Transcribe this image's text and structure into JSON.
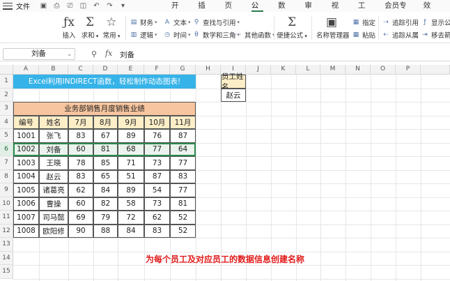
{
  "menubar": {
    "file_label": "文件",
    "tabs": [
      "开始",
      "插入",
      "页面",
      "公式",
      "数据",
      "审阅",
      "视图",
      "工具",
      "会员专享",
      "效率"
    ],
    "active_tab": "公式"
  },
  "ribbon": {
    "insert_function": "插入",
    "autosum": "求和",
    "common": "常用",
    "finance": "财务",
    "text": "文本",
    "lookup": "查找与引用",
    "logic": "逻辑",
    "time": "时间",
    "math": "数学和三角",
    "other": "其他函数",
    "quick_formula": "便捷公式",
    "name_manager": "名称管理器",
    "specify": "指定",
    "paste": "粘贴",
    "trace_precedents": "追踪引用",
    "trace_dependents": "追踪从属",
    "show_formula": "显示公",
    "remove_arrows": "移去箭"
  },
  "formula_bar": {
    "name_box": "刘备",
    "fx": "fx",
    "value": "刘备"
  },
  "columns": [
    "A",
    "B",
    "C",
    "D",
    "E",
    "F",
    "G",
    "H",
    "I",
    "J",
    "K",
    "L",
    "M",
    "N",
    "O",
    "P"
  ],
  "rows": [
    "1",
    "2",
    "3",
    "4",
    "5",
    "6",
    "7",
    "8",
    "9",
    "10",
    "11",
    "12",
    "13",
    "14",
    "15"
  ],
  "sheet": {
    "banner": "Excel利用INDIRECT函数，轻松制作动态图表!",
    "table_title": "业务部销售月度销售业绩",
    "headers": [
      "编号",
      "姓名",
      "7月",
      "8月",
      "9月",
      "10月",
      "11月"
    ],
    "records": [
      [
        "1001",
        "张飞",
        "83",
        "67",
        "89",
        "76",
        "87"
      ],
      [
        "1002",
        "刘备",
        "60",
        "81",
        "68",
        "77",
        "64"
      ],
      [
        "1003",
        "王晓",
        "78",
        "85",
        "71",
        "73",
        "77"
      ],
      [
        "1004",
        "赵云",
        "83",
        "65",
        "51",
        "87",
        "83"
      ],
      [
        "1005",
        "诸葛亮",
        "62",
        "84",
        "89",
        "54",
        "77"
      ],
      [
        "1006",
        "曹操",
        "60",
        "82",
        "58",
        "73",
        "81"
      ],
      [
        "1007",
        "司马懿",
        "69",
        "79",
        "72",
        "62",
        "52"
      ],
      [
        "1008",
        "欧阳修",
        "90",
        "88",
        "84",
        "83",
        "52"
      ]
    ],
    "employee_label": "员工姓名",
    "employee_value": "赵云",
    "caption": "为每个员工及对应员工的数据信息创建名称"
  },
  "colors": {
    "banner": "#36b3e8",
    "title_fill": "#f7c59f",
    "header_fill": "#fdeec8",
    "selection": "#2a8a4f",
    "caption": "#e21b1b"
  }
}
